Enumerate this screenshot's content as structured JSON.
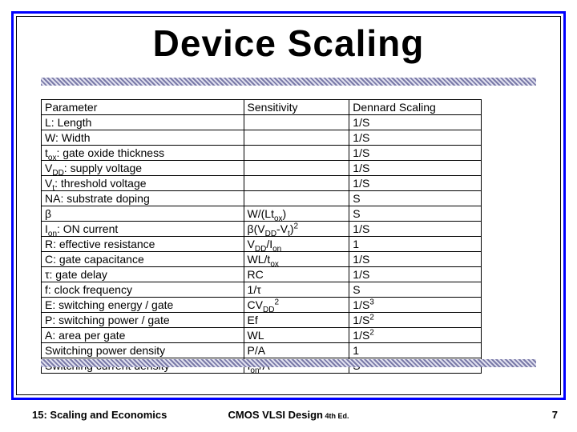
{
  "title": "Device Scaling",
  "headers": {
    "parameter": "Parameter",
    "sensitivity": "Sensitivity",
    "dennard": "Dennard Scaling"
  },
  "rows": [
    {
      "param": "L: Length",
      "sens": "",
      "denn": "1/S"
    },
    {
      "param": "W: Width",
      "sens": "",
      "denn": "1/S"
    },
    {
      "param": "t<sub class='sub'>ox</sub>: gate oxide thickness",
      "sens": "",
      "denn": "1/S"
    },
    {
      "param": "V<sub class='sub'>DD</sub>: supply voltage",
      "sens": "",
      "denn": "1/S"
    },
    {
      "param": "V<sub class='sub'>t</sub>: threshold voltage",
      "sens": "",
      "denn": "1/S"
    },
    {
      "param": "NA: substrate doping",
      "sens": "",
      "denn": "S"
    },
    {
      "param": "β",
      "sens": "W/(Lt<sub class='sub'>ox</sub>)",
      "denn": "S"
    },
    {
      "param": "I<sub class='sub'>on</sub>: ON current",
      "sens": "β(V<sub class='sub'>DD</sub>-V<sub class='sub'>t</sub>)<sup class='sup'>2</sup>",
      "denn": "1/S"
    },
    {
      "param": "R: effective resistance",
      "sens": "V<sub class='sub'>DD</sub>/I<sub class='sub'>on</sub>",
      "denn": "1"
    },
    {
      "param": "C: gate capacitance",
      "sens": "WL/t<sub class='sub'>ox</sub>",
      "denn": "1/S"
    },
    {
      "param": "τ: gate delay",
      "sens": "RC",
      "denn": "1/S"
    },
    {
      "param": "f: clock frequency",
      "sens": "1/τ",
      "denn": "S"
    },
    {
      "param": "E: switching energy / gate",
      "sens": "CV<sub class='sub'>DD</sub><sup class='sup'>2</sup>",
      "denn": "1/S<sup class='sup'>3</sup>"
    },
    {
      "param": "P: switching power / gate",
      "sens": "Ef",
      "denn": "1/S<sup class='sup'>2</sup>"
    },
    {
      "param": "A: area per gate",
      "sens": "WL",
      "denn": "1/S<sup class='sup'>2</sup>"
    },
    {
      "param": "Switching power density",
      "sens": "P/A",
      "denn": "1"
    },
    {
      "param": "Switching current density",
      "sens": "I<sub class='sub'>on</sub>/A",
      "denn": "S"
    }
  ],
  "footer": {
    "left": "15: Scaling and Economics",
    "center_main": "CMOS VLSI Design",
    "center_ed": " 4th Ed.",
    "right": "7"
  },
  "chart_data": {
    "type": "table",
    "title": "Device Scaling (Dennard Scaling)",
    "columns": [
      "Parameter",
      "Sensitivity",
      "Dennard Scaling"
    ],
    "rows": [
      [
        "L: Length",
        "",
        "1/S"
      ],
      [
        "W: Width",
        "",
        "1/S"
      ],
      [
        "t_ox: gate oxide thickness",
        "",
        "1/S"
      ],
      [
        "V_DD: supply voltage",
        "",
        "1/S"
      ],
      [
        "V_t: threshold voltage",
        "",
        "1/S"
      ],
      [
        "NA: substrate doping",
        "",
        "S"
      ],
      [
        "beta",
        "W/(L*t_ox)",
        "S"
      ],
      [
        "I_on: ON current",
        "beta*(V_DD - V_t)^2",
        "1/S"
      ],
      [
        "R: effective resistance",
        "V_DD / I_on",
        "1"
      ],
      [
        "C: gate capacitance",
        "W*L / t_ox",
        "1/S"
      ],
      [
        "tau: gate delay",
        "R*C",
        "1/S"
      ],
      [
        "f: clock frequency",
        "1/tau",
        "S"
      ],
      [
        "E: switching energy / gate",
        "C*V_DD^2",
        "1/S^3"
      ],
      [
        "P: switching power / gate",
        "E*f",
        "1/S^2"
      ],
      [
        "A: area per gate",
        "W*L",
        "1/S^2"
      ],
      [
        "Switching power density",
        "P/A",
        "1"
      ],
      [
        "Switching current density",
        "I_on / A",
        "S"
      ]
    ]
  }
}
